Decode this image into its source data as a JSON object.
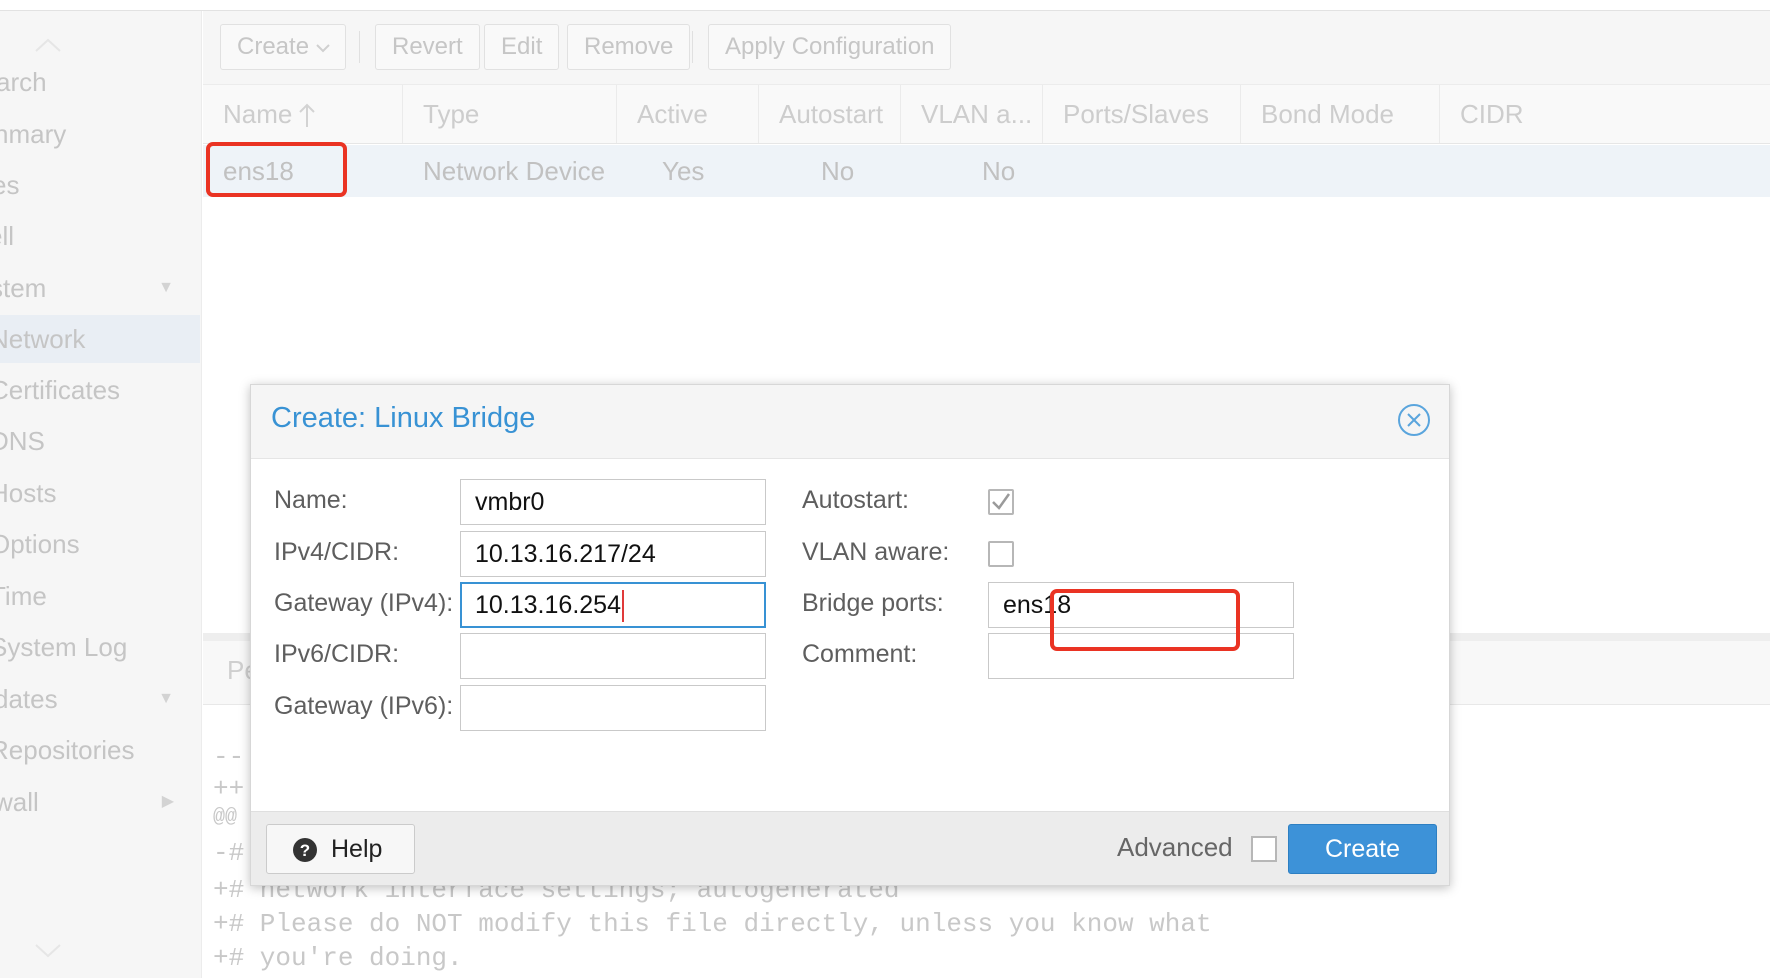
{
  "sidebar": {
    "items": [
      {
        "label": "arch"
      },
      {
        "label": "nmary"
      },
      {
        "label": "es"
      },
      {
        "label": "ell"
      },
      {
        "label": "stem"
      },
      {
        "label": "Network"
      },
      {
        "label": "Certificates"
      },
      {
        "label": "DNS"
      },
      {
        "label": "Hosts"
      },
      {
        "label": "Options"
      },
      {
        "label": "Time"
      },
      {
        "label": "System Log"
      },
      {
        "label": "dates"
      },
      {
        "label": "Repositories"
      },
      {
        "label": "wall"
      }
    ]
  },
  "toolbar": {
    "create_label": "Create",
    "revert_label": "Revert",
    "edit_label": "Edit",
    "remove_label": "Remove",
    "apply_label": "Apply Configuration"
  },
  "grid": {
    "columns": [
      "Name",
      "Type",
      "Active",
      "Autostart",
      "VLAN a...",
      "Ports/Slaves",
      "Bond Mode",
      "CIDR"
    ],
    "rows": [
      {
        "name": "ens18",
        "type": "Network Device",
        "active": "Yes",
        "autostart": "No",
        "vlan": "No"
      }
    ]
  },
  "lower_panel": {
    "tab_label": "Pe",
    "code_lines": [
      "--",
      "++",
      "@@",
      "-#",
      "+# network interface settings; autogenerated",
      "+# Please do NOT modify this file directly, unless you know what",
      "+# you're doing."
    ]
  },
  "dialog": {
    "title": "Create: Linux Bridge",
    "labels": {
      "name": "Name:",
      "ipv4": "IPv4/CIDR:",
      "gateway4": "Gateway (IPv4):",
      "ipv6": "IPv6/CIDR:",
      "gateway6": "Gateway (IPv6):",
      "autostart": "Autostart:",
      "vlan_aware": "VLAN aware:",
      "bridge_ports": "Bridge ports:",
      "comment": "Comment:"
    },
    "values": {
      "name": "vmbr0",
      "ipv4": "10.13.16.217/24",
      "gateway4": "10.13.16.254",
      "ipv6": "",
      "gateway6": "",
      "bridge_ports": "ens18",
      "comment": ""
    },
    "autostart_checked": true,
    "vlan_aware_checked": false,
    "footer": {
      "help_label": "Help",
      "advanced_label": "Advanced",
      "advanced_checked": false,
      "create_label": "Create"
    }
  },
  "colors": {
    "accent": "#3892d4",
    "highlight": "#ea3323"
  }
}
